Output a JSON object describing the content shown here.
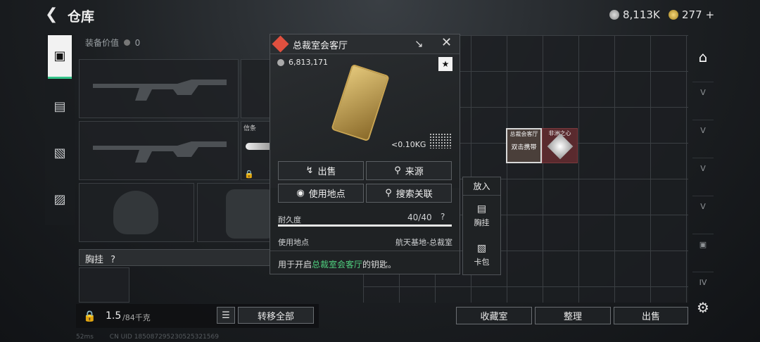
{
  "header": {
    "title": "仓库"
  },
  "currency": {
    "silver": "8,113K",
    "gold": "277",
    "gold_plus": "+"
  },
  "equipment": {
    "label": "装备价值",
    "value": "0",
    "slot_label_letter": "信条"
  },
  "chest": {
    "label": "胸挂",
    "help": "?"
  },
  "weight": {
    "current": "1.5",
    "max": "/84千克"
  },
  "bottom_left": {
    "transfer_all": "转移全部"
  },
  "popup": {
    "title": "总裁室会客厅",
    "price": "6,813,171",
    "weight": "<0.10KG",
    "buttons": {
      "sell": "出售",
      "source": "来源",
      "use_location": "使用地点",
      "search_related": "搜索关联"
    },
    "durability_label": "耐久度",
    "durability_value": "40/40",
    "help": "?",
    "use_location_label": "使用地点",
    "use_location_value": "航天基地-总裁室",
    "desc_prefix": "用于开启",
    "desc_highlight": "总裁室会客厅",
    "desc_suffix": "的钥匙。"
  },
  "put_into": {
    "title": "放入",
    "chest": "胸挂",
    "card_pack": "卡包"
  },
  "grid_items": {
    "item1_name": "总裁会客厅",
    "item1_hint": "双击携带",
    "item2_name": "非洲之心"
  },
  "bottom_right": {
    "collection": "收藏室",
    "sort": "整理",
    "sell": "出售"
  },
  "status": {
    "ping": "52ms",
    "uid": "CN UID 1850872952305253215​69"
  },
  "colors": {
    "accent": "#36c48a",
    "popup_icon": "#e0503f",
    "highlight_text": "#4fd07f"
  }
}
